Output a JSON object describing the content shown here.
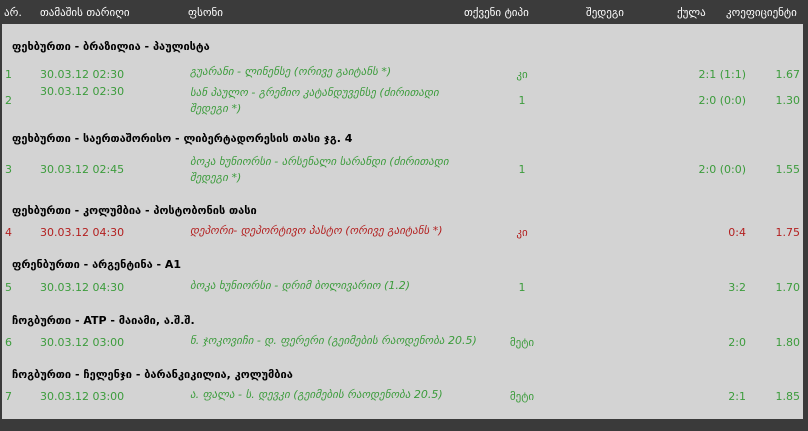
{
  "header": {
    "num": "არ.",
    "date": "თამაშის თარიღი",
    "event": "ფსონი",
    "bet_type": "თქვენი ტიპი",
    "result": "შედეგი",
    "score": "ქულა",
    "odds": "კოეფიციენტი"
  },
  "groups": [
    {
      "title": "ფეხბურთი - ბრაზილია - პაულისტა",
      "rows": [
        {
          "num": "1",
          "date": "30.03.12 02:30",
          "event": "გუარანი - ლინენსე (ორივე გაიტანს *)",
          "event_l2": "",
          "bet": "კი",
          "score": "2:1 (1:1)",
          "odds": "1.67",
          "status": "win"
        },
        {
          "num": "2",
          "date": "30.03.12 02:30",
          "event": "სან პაულო - გრემიო კატანდუვენსე (ძირითადი",
          "event_l2": "შედეგი *)",
          "bet": "1",
          "score": "2:0 (0:0)",
          "odds": "1.30",
          "status": "win"
        }
      ]
    },
    {
      "title": "ფეხბურთი - საერთაშორისო - ლიბერტადორესის თასი ჯგ. 4",
      "rows": [
        {
          "num": "3",
          "date": "30.03.12 02:45",
          "event": "ბოკა ხუნიორსი - არსენალი სარანდი (ძირითადი",
          "event_l2": "შედეგი *)",
          "bet": "1",
          "score": "2:0 (0:0)",
          "odds": "1.55",
          "status": "win"
        }
      ]
    },
    {
      "title": "ფეხბურთი - კოლუმბია - პოსტობონის თასი",
      "rows": [
        {
          "num": "4",
          "date": "30.03.12 04:30",
          "event": "დეპორი- დეპორტივო პასტო (ორივე გაიტანს *)",
          "event_l2": "",
          "bet": "კი",
          "score": "0:4",
          "odds": "1.75",
          "status": "lose"
        }
      ]
    },
    {
      "title": "ფრენბურთი - არგენტინა - A1",
      "rows": [
        {
          "num": "5",
          "date": "30.03.12 04:30",
          "event": "ბოკა ხუნიორსი - დრიმ ბოლივარიო (1.2)",
          "event_l2": "",
          "bet": "1",
          "score": "3:2",
          "odds": "1.70",
          "status": "win"
        }
      ]
    },
    {
      "title": "ჩოგბურთი - ATP - მაიამი, ა.შ.შ.",
      "rows": [
        {
          "num": "6",
          "date": "30.03.12 03:00",
          "event": "ნ. ჯოკოვიჩი - დ. ფერერი (გეიმების რაოდენობა 20.5)",
          "event_l2": "",
          "bet": "მეტი",
          "score": "2:0",
          "odds": "1.80",
          "status": "win"
        }
      ]
    },
    {
      "title": "ჩოგბურთი - ჩელენჯი - ბარანკიკილია, კოლუმბია",
      "rows": [
        {
          "num": "7",
          "date": "30.03.12 03:00",
          "event": "ა. ფალა - ს. დევკი (გეიმების რაოდენობა 20.5)",
          "event_l2": "",
          "bet": "მეტი",
          "score": "2:1",
          "odds": "1.85",
          "status": "win"
        }
      ]
    }
  ]
}
